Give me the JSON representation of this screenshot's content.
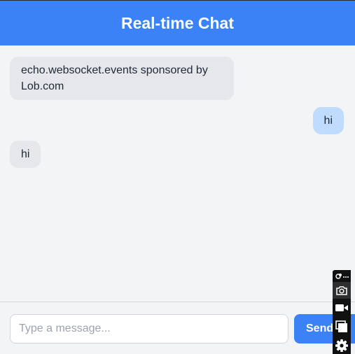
{
  "header": {
    "title": "Real-time Chat"
  },
  "messages": [
    {
      "direction": "received",
      "text": "echo.websocket.events sponsored by Lob.com"
    },
    {
      "direction": "sent",
      "text": "hi"
    },
    {
      "direction": "received",
      "text": "hi"
    }
  ],
  "composer": {
    "placeholder": "Type a message...",
    "send_label": "Send"
  },
  "overlay_toolbar": {
    "icons": [
      "extension-icon",
      "more-icon",
      "screenshot-camera-icon",
      "video-record-icon",
      "window-icon",
      "settings-gear-icon"
    ]
  },
  "colors": {
    "accent": "#3b82f6",
    "background": "#f3f4f6",
    "received_bubble": "#e5e7eb",
    "sent_bubble": "#bfdbfe"
  }
}
